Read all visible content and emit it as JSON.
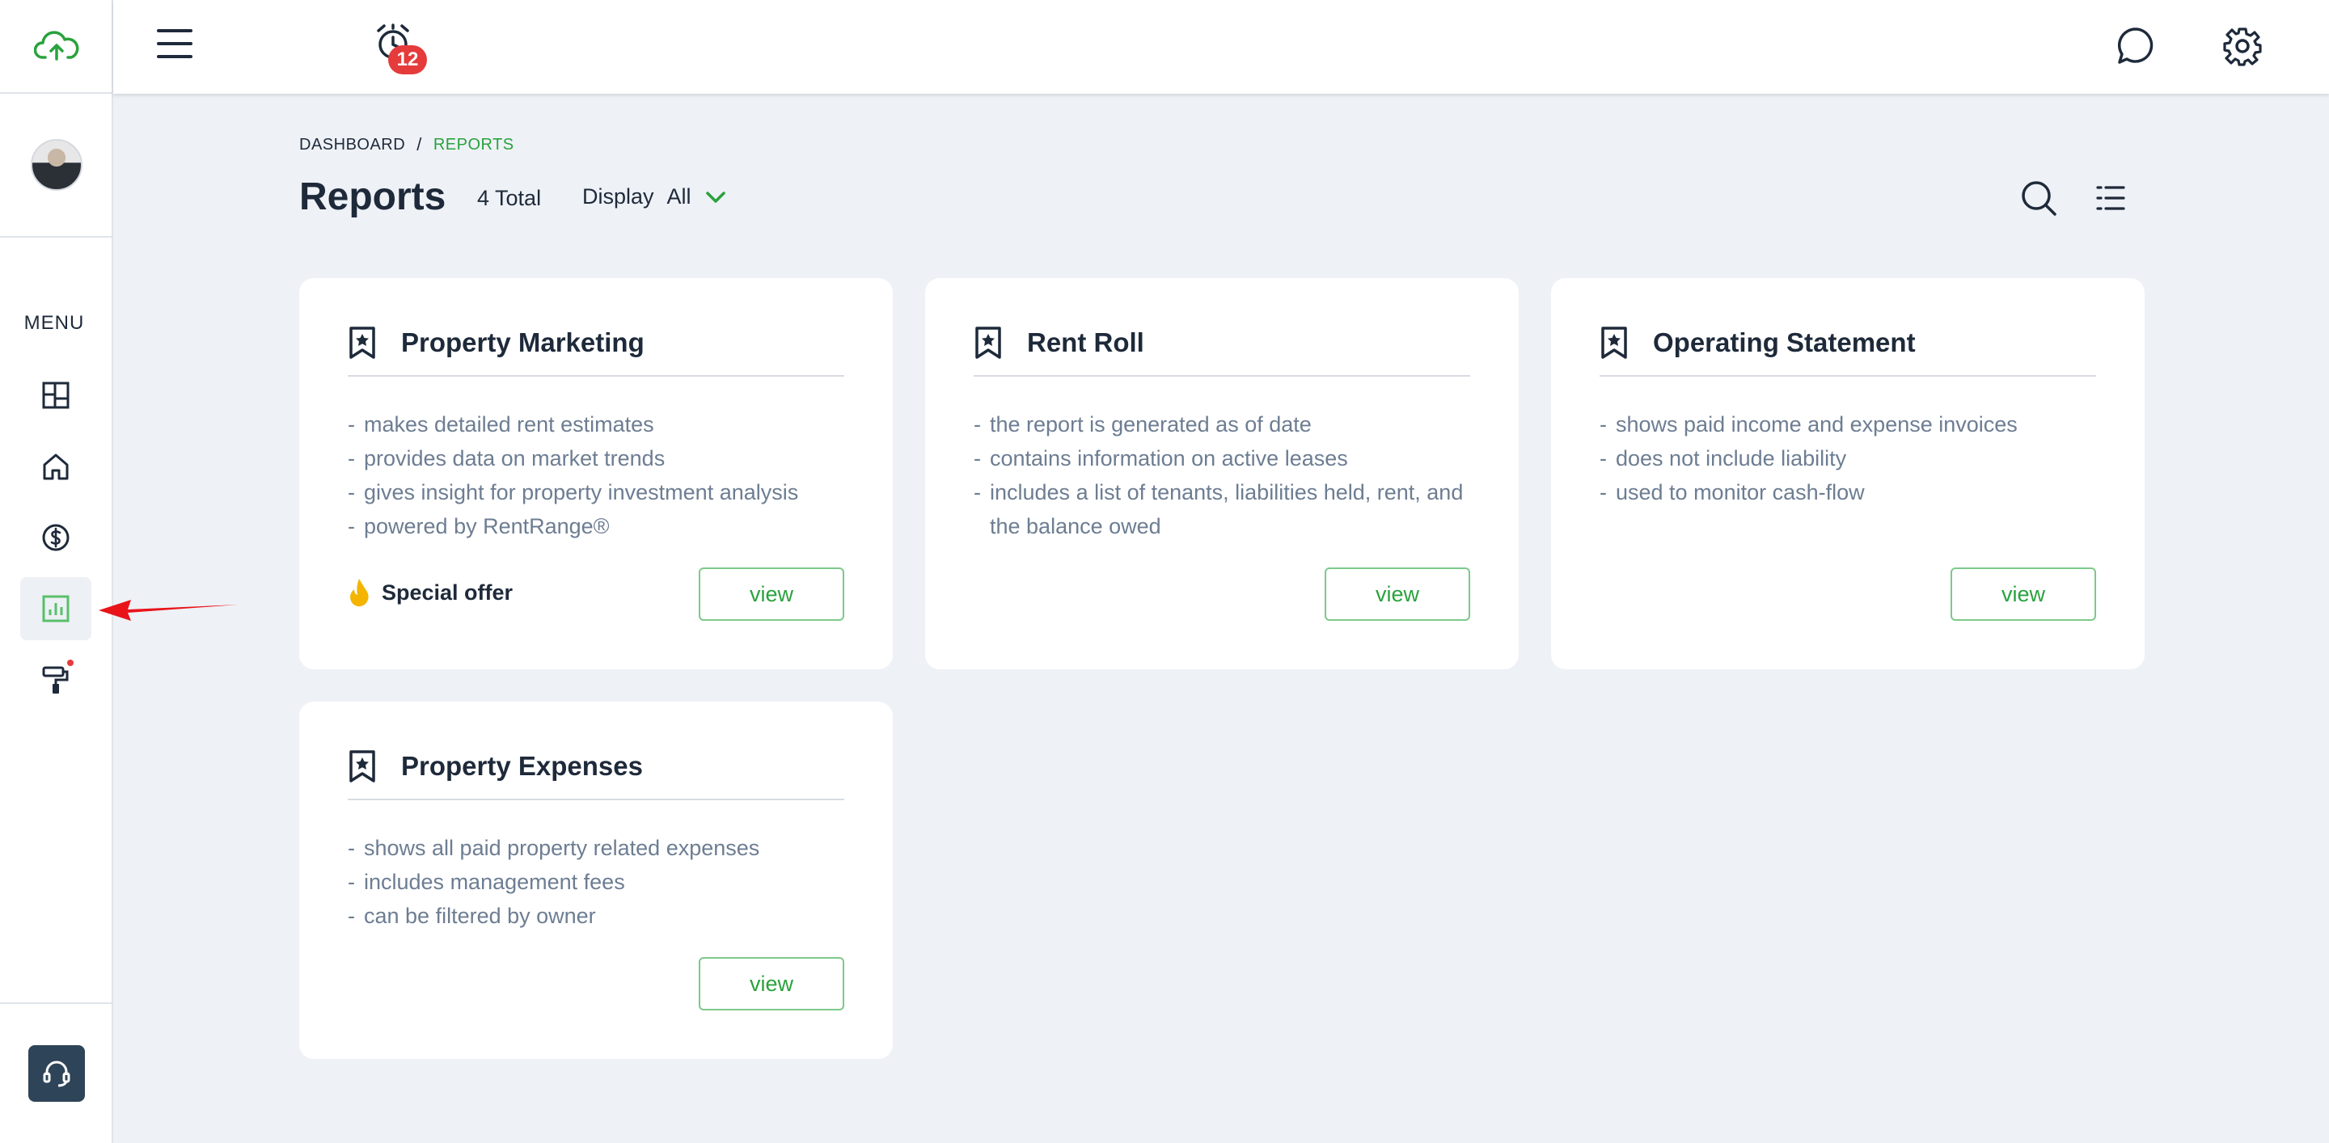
{
  "colors": {
    "accent": "#2aa23d",
    "badge": "#e53b3b",
    "text_dark": "#1e2a3a",
    "text_muted": "#6d7d92",
    "arrow": "#e8141a"
  },
  "sidebar": {
    "menu_label": "MENU",
    "items": [
      {
        "name": "dashboard",
        "icon": "layout-grid-icon"
      },
      {
        "name": "properties",
        "icon": "home-icon"
      },
      {
        "name": "accounting",
        "icon": "dollar-circle-icon"
      },
      {
        "name": "reports",
        "icon": "bar-chart-icon",
        "active": true
      },
      {
        "name": "maintenance",
        "icon": "paint-roller-icon",
        "notification_dot": true
      }
    ],
    "support_icon": "headset-icon"
  },
  "topbar": {
    "notification_count": "12",
    "icons": [
      "cloud-upload-icon",
      "hamburger-menu-icon",
      "alarm-clock-icon",
      "chat-icon",
      "gear-icon"
    ]
  },
  "breadcrumb": {
    "home": "DASHBOARD",
    "separator": "/",
    "current": "REPORTS"
  },
  "header": {
    "title": "Reports",
    "total": "4 Total",
    "display_label": "Display",
    "display_value": "All"
  },
  "cards": [
    {
      "title": "Property Marketing",
      "bullets": [
        "makes detailed rent estimates",
        "provides data on market trends",
        "gives insight for property investment analysis",
        "powered by RentRange®"
      ],
      "special_offer": "Special offer",
      "button": "view"
    },
    {
      "title": "Rent Roll",
      "bullets": [
        "the report is generated as of date",
        "contains information on active leases",
        "includes a list of tenants, liabilities held, rent, and the balance owed"
      ],
      "button": "view"
    },
    {
      "title": "Operating Statement",
      "bullets": [
        "shows paid income and expense invoices",
        "does not include liability",
        "used to monitor cash-flow"
      ],
      "button": "view"
    },
    {
      "title": "Property Expenses",
      "bullets": [
        "shows all paid property related expenses",
        "includes management fees",
        "can be filtered by owner"
      ],
      "button": "view"
    }
  ]
}
